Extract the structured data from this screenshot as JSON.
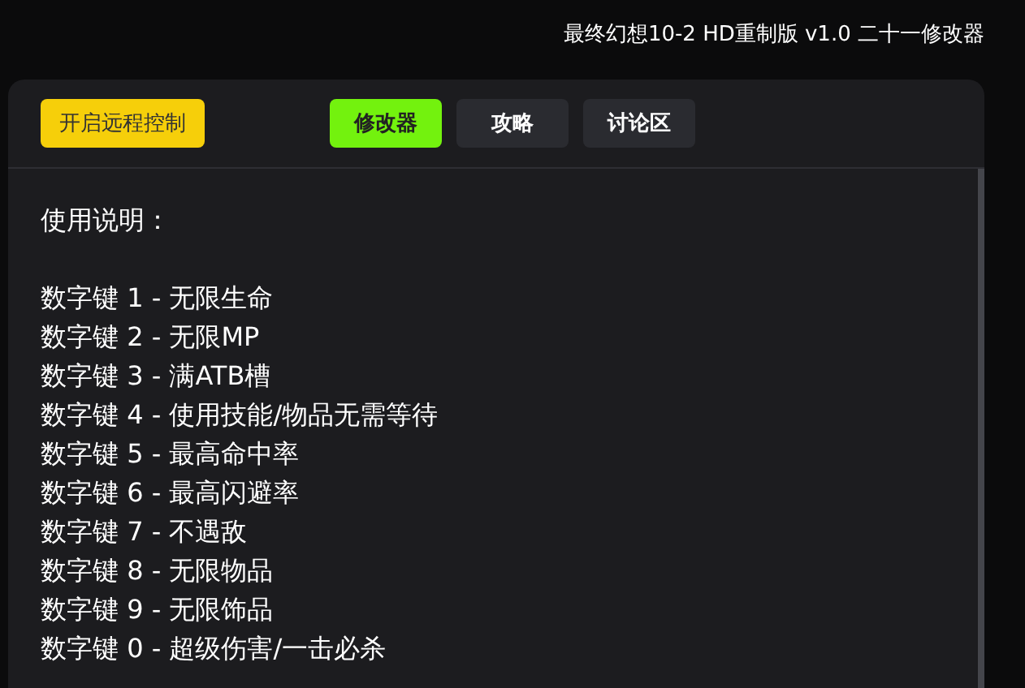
{
  "window": {
    "title": "最终幻想10-2 HD重制版 v1.0 二十一修改器"
  },
  "remote_button": {
    "label": "开启远程控制"
  },
  "tabs": [
    {
      "label": "修改器",
      "selected": true
    },
    {
      "label": "攻略",
      "selected": false
    },
    {
      "label": "讨论区",
      "selected": false
    }
  ],
  "instructions": {
    "heading": "使用说明：",
    "lines": [
      "数字键 1 - 无限生命",
      "数字键 2 - 无限MP",
      "数字键 3 - 满ATB槽",
      "数字键 4 - 使用技能/物品无需等待",
      "数字键 5 - 最高命中率",
      "数字键 6 - 最高闪避率",
      "数字键 7 - 不遇敌",
      "数字键 8 - 无限物品",
      "数字键 9 - 无限饰品",
      "数字键 0 - 超级伤害/一击必杀"
    ]
  }
}
